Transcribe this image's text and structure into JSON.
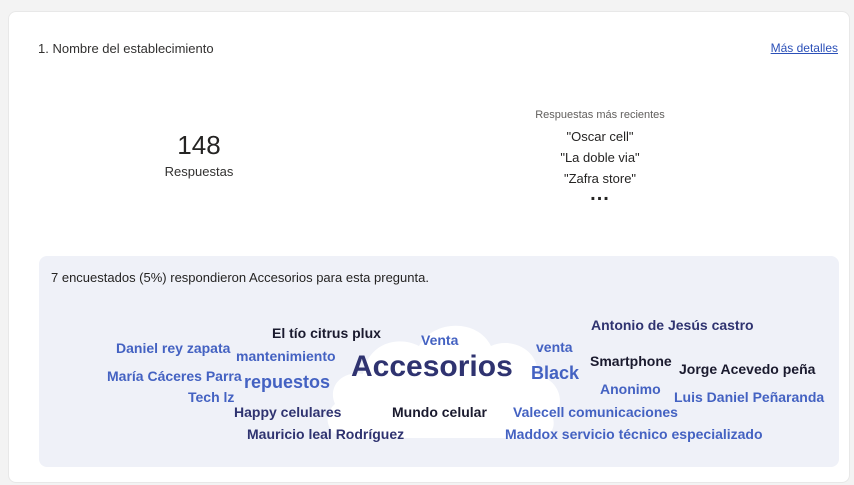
{
  "question": {
    "title": "1. Nombre del establecimiento",
    "details_link": "Más detalles"
  },
  "summary": {
    "count": "148",
    "count_label": "Respuestas"
  },
  "recent": {
    "title": "Respuestas más recientes",
    "items": [
      "\"Oscar cell\"",
      "\"La doble via\"",
      "\"Zafra store\""
    ],
    "more": "..."
  },
  "word_cloud": {
    "caption": "7 encuestados (5%) respondieron Accesorios para esta pregunta.",
    "selected_word": "Accesorios",
    "words": [
      "Antonio de Jesús castro",
      "El tío citrus plux",
      "Venta",
      "Daniel rey zapata",
      "mantenimiento",
      "venta",
      "Smartphone",
      "Jorge Acevedo peña",
      "María Cáceres Parra",
      "repuestos",
      "Accesorios",
      "Black",
      "Anonimo",
      "Luis Daniel Peñaranda",
      "Tech lz",
      "Happy celulares",
      "Mundo celular",
      "Valecell comunicaciones",
      "Mauricio leal Rodríguez",
      "Maddox servicio técnico especializado"
    ]
  },
  "colors": {
    "accent_blue": "#4462c2",
    "dark_navy": "#2f3370",
    "panel_bg": "#eff1f8"
  }
}
